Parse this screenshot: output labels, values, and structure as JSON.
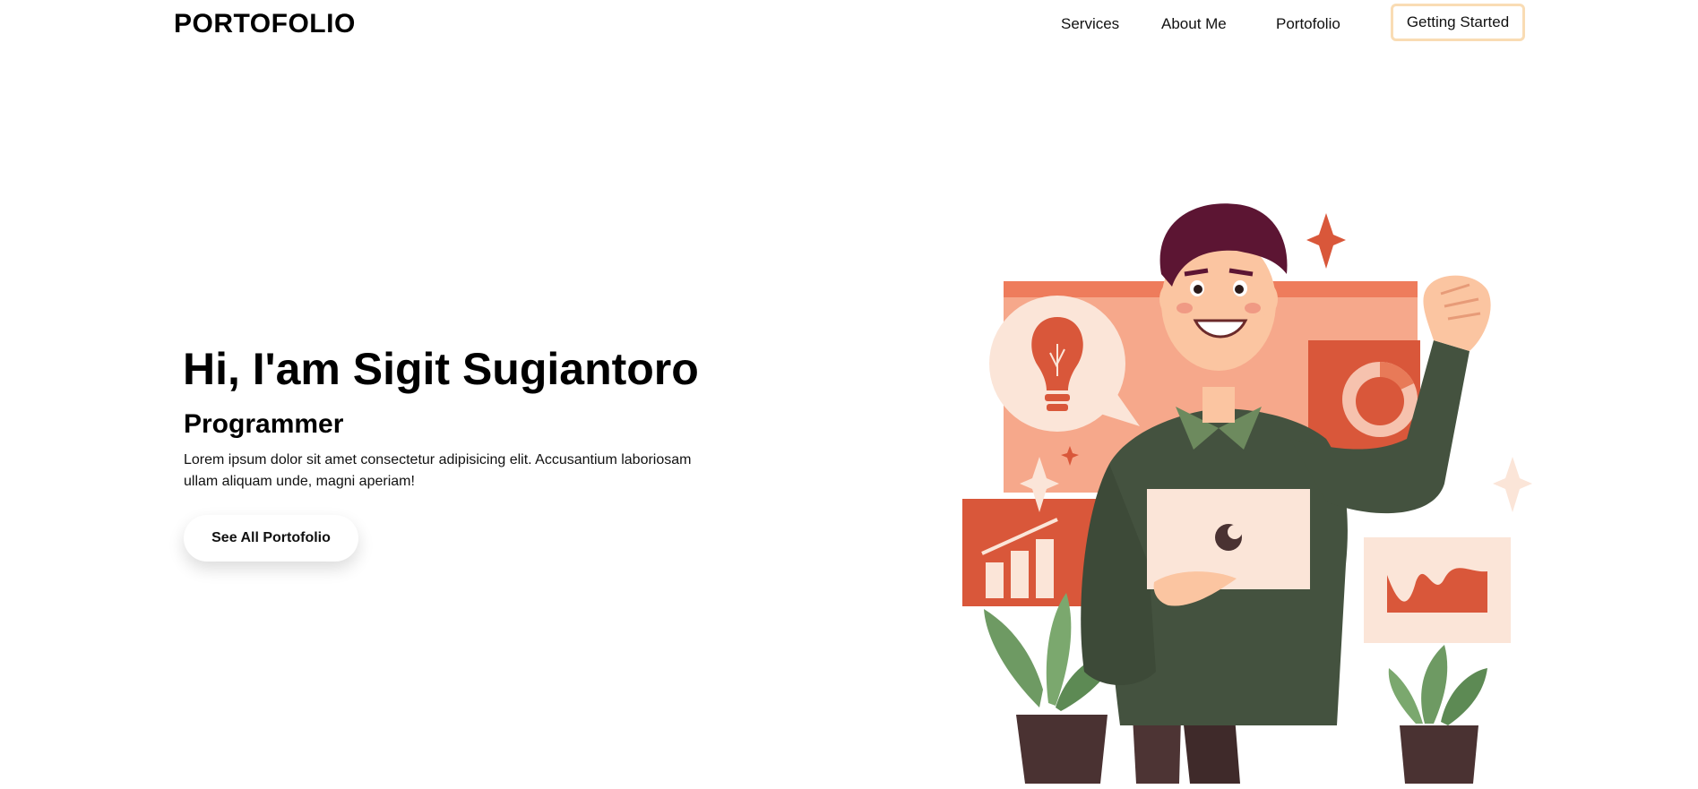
{
  "navbar": {
    "brand": "PORTOFOLIO",
    "links": [
      "Services",
      "About Me",
      "Portofolio"
    ],
    "cta_label": "Getting Started"
  },
  "hero": {
    "title": "Hi, I'am Sigit Sugiantoro",
    "role": "Programmer",
    "description": "Lorem ipsum dolor sit amet consectetur adipisicing elit. Accusantium laboriosam ullam aliquam unde, magni aperiam!",
    "button_label": "See All Portofolio"
  },
  "illustration": {
    "subject": "man-holding-laptop-illustration",
    "colors": {
      "primary": "#d9573a",
      "light": "#f6a88b",
      "pale": "#fbe5d8",
      "sweater": "#44523f",
      "collar": "#6d8a5e",
      "hair": "#5c1533",
      "skin": "#fbc5a1",
      "pot": "#4a3232",
      "leaf": "#6e9a63"
    }
  },
  "accent": {
    "cta_border": "#f9dcb4"
  }
}
